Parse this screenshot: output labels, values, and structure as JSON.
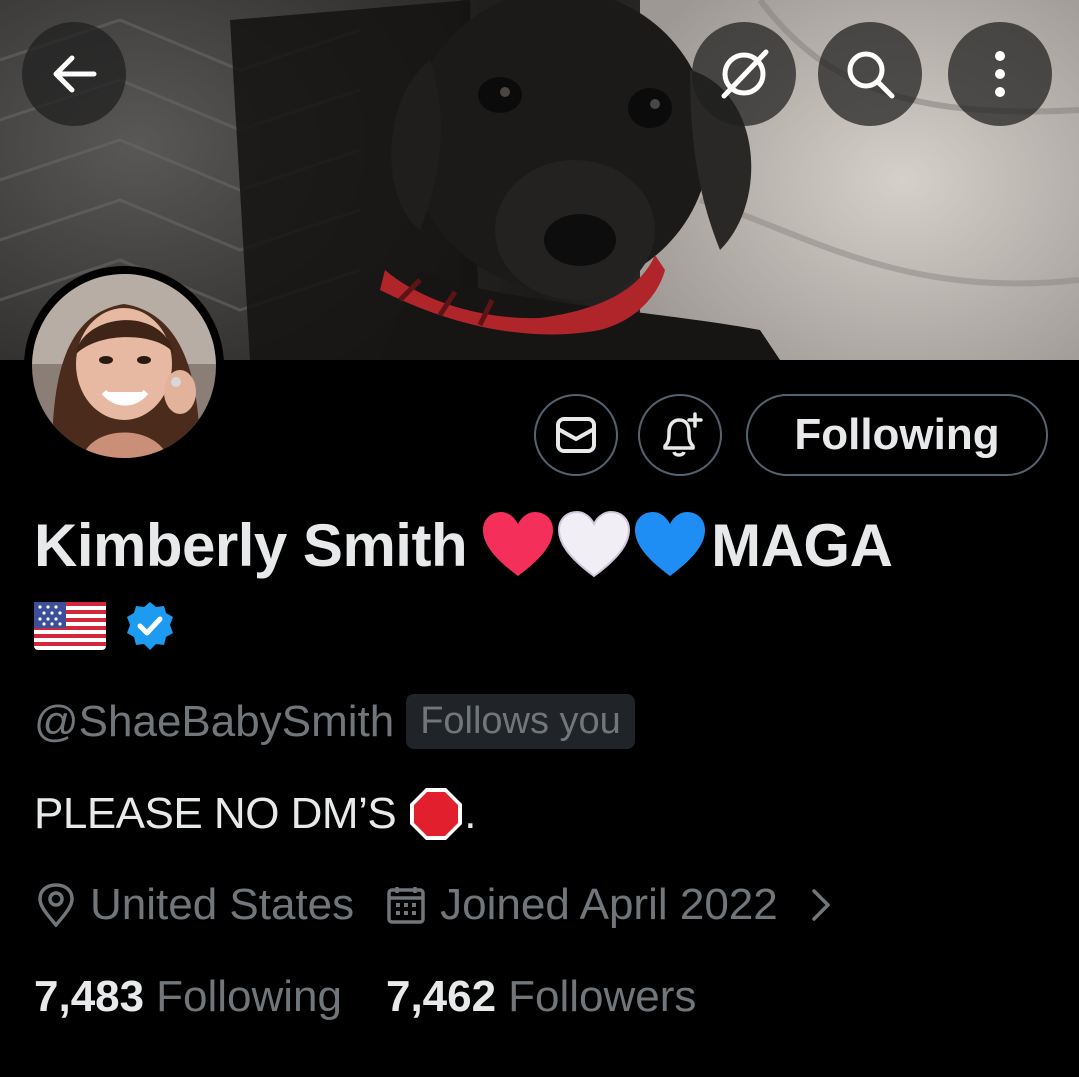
{
  "header": {
    "back_icon": "arrow-left-icon",
    "grok_icon": "grok-icon",
    "search_icon": "search-icon",
    "more_icon": "more-vertical-icon"
  },
  "actions": {
    "message_icon": "mail-icon",
    "notify_icon": "bell-plus-icon",
    "following_label": "Following"
  },
  "profile": {
    "name": "Kimberly Smith",
    "name_emojis": [
      "red-heart",
      "white-heart",
      "blue-heart"
    ],
    "name_suffix": "MAGA",
    "flag": "us-flag",
    "verified": true,
    "handle": "@ShaeBabySmith",
    "follows_you": "Follows you",
    "bio_text": "PLEASE NO DM’S",
    "bio_emoji": "stop-sign",
    "bio_end": ".",
    "location": "United States",
    "joined": "Joined April 2022"
  },
  "stats": {
    "following_count": "7,483",
    "following_label": "Following",
    "followers_count": "7,462",
    "followers_label": "Followers"
  },
  "colors": {
    "background": "#000000",
    "text_primary": "#e7e9ea",
    "text_secondary": "#71767b",
    "border": "#536471",
    "verified_blue": "#1d9bf0"
  }
}
